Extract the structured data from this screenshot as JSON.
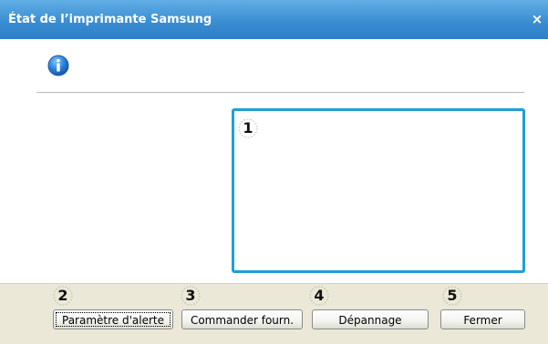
{
  "window": {
    "title": "État de l’imprimante Samsung",
    "close_symbol": "×"
  },
  "content": {
    "info_icon": "info-icon",
    "markers": [
      "1",
      "2",
      "3",
      "4",
      "5"
    ]
  },
  "buttons": {
    "alert_settings": "Paramètre d'alerte",
    "order_supplies": "Commander fourn.",
    "troubleshooting": "Dépannage",
    "close": "Fermer"
  },
  "colors": {
    "title_bar": "#3a8ed2",
    "highlight_border": "#1e9fd9",
    "footer_bg": "#ebe8d8"
  }
}
